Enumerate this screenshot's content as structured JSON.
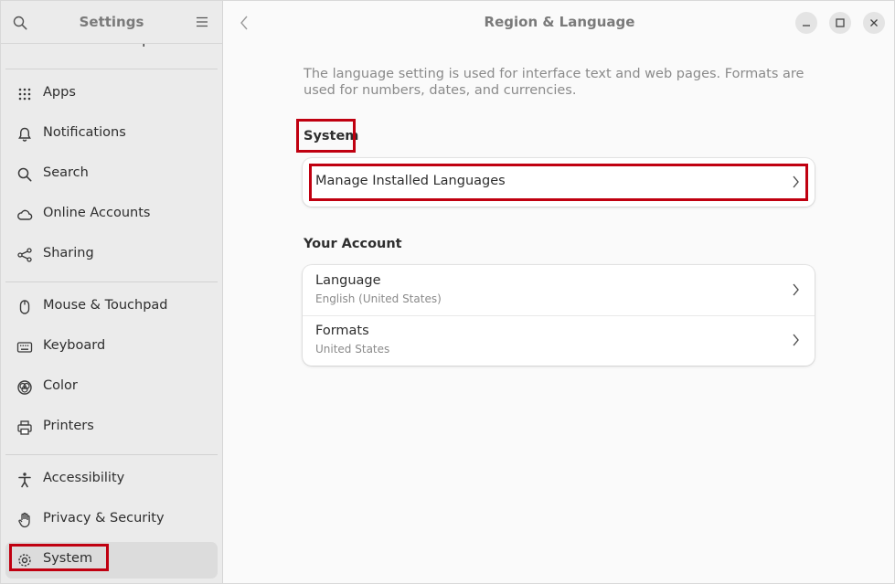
{
  "sidebar": {
    "title": "Settings",
    "items": [
      {
        "label": "Ubuntu Desktop",
        "icon": "ubuntu-desktop-icon"
      },
      {
        "label": "Apps",
        "icon": "apps-grid-icon"
      },
      {
        "label": "Notifications",
        "icon": "bell-icon"
      },
      {
        "label": "Search",
        "icon": "search-icon"
      },
      {
        "label": "Online Accounts",
        "icon": "cloud-icon"
      },
      {
        "label": "Sharing",
        "icon": "share-icon"
      },
      {
        "label": "Mouse & Touchpad",
        "icon": "mouse-icon"
      },
      {
        "label": "Keyboard",
        "icon": "keyboard-icon"
      },
      {
        "label": "Color",
        "icon": "color-icon"
      },
      {
        "label": "Printers",
        "icon": "printer-icon"
      },
      {
        "label": "Accessibility",
        "icon": "accessibility-icon"
      },
      {
        "label": "Privacy & Security",
        "icon": "hand-icon"
      },
      {
        "label": "System",
        "icon": "gear-icon",
        "selected": true
      }
    ]
  },
  "main": {
    "title": "Region & Language",
    "description": "The language setting is used for interface text and web pages. Formats are used for numbers, dates, and currencies.",
    "system_section": {
      "title": "System",
      "rows": [
        {
          "label": "Manage Installed Languages"
        }
      ]
    },
    "account_section": {
      "title": "Your Account",
      "rows": [
        {
          "label": "Language",
          "value": "English (United States)"
        },
        {
          "label": "Formats",
          "value": "United States"
        }
      ]
    }
  },
  "colors": {
    "highlight": "#c00010",
    "sidebar_bg": "#ebebeb",
    "main_bg": "#fafafa"
  }
}
